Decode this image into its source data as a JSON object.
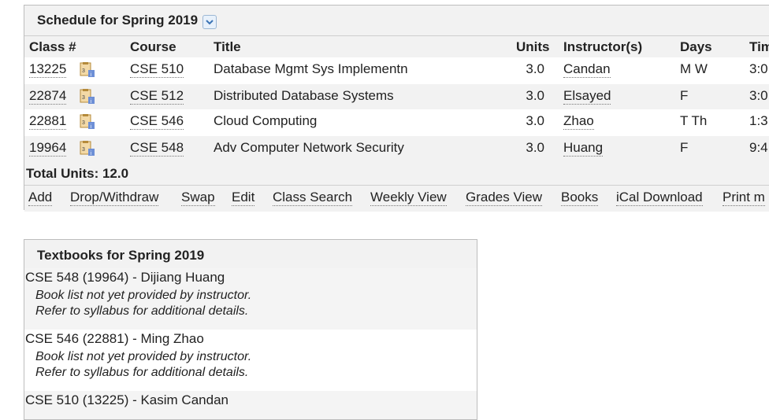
{
  "schedule": {
    "title": "Schedule for Spring 2019",
    "headers": {
      "class_num": "Class #",
      "course": "Course",
      "title": "Title",
      "units": "Units",
      "instructors": "Instructor(s)",
      "days": "Days",
      "time": "Tim"
    },
    "rows": [
      {
        "class_num": "13225",
        "course": "CSE 510",
        "title": "Database Mgmt Sys Implementn",
        "units": "3.0",
        "instructor": "Candan",
        "days": "M W",
        "time": "3:0"
      },
      {
        "class_num": "22874",
        "course": "CSE 512",
        "title": "Distributed Database Systems",
        "units": "3.0",
        "instructor": "Elsayed",
        "days": "F",
        "time": "3:0"
      },
      {
        "class_num": "22881",
        "course": "CSE 546",
        "title": "Cloud Computing",
        "units": "3.0",
        "instructor": "Zhao",
        "days": "T Th",
        "time": "1:3"
      },
      {
        "class_num": "19964",
        "course": "CSE 548",
        "title": "Adv Computer Network Security",
        "units": "3.0",
        "instructor": "Huang",
        "days": "F",
        "time": "9:4"
      }
    ],
    "total_units": "Total Units: 12.0",
    "actions": [
      "Add",
      "Drop/Withdraw",
      "Swap",
      "Edit",
      "Class Search",
      "Weekly View",
      "Grades View",
      "Books",
      "iCal Download",
      "Print m"
    ]
  },
  "textbooks": {
    "title": "Textbooks for Spring 2019",
    "entries": [
      {
        "course": "CSE 548 (19964) - Dijiang Huang",
        "note1": "Book list not yet provided by instructor.",
        "note2": "Refer to syllabus for additional details."
      },
      {
        "course": "CSE 546 (22881) - Ming Zhao",
        "note1": "Book list not yet provided by instructor.",
        "note2": "Refer to syllabus for additional details."
      },
      {
        "course": "CSE 510 (13225) - Kasim Candan",
        "note1": "",
        "note2": ""
      }
    ]
  },
  "icons": {
    "semester_toggle": "chevron-down-icon",
    "class_details": "book-info-icon"
  }
}
